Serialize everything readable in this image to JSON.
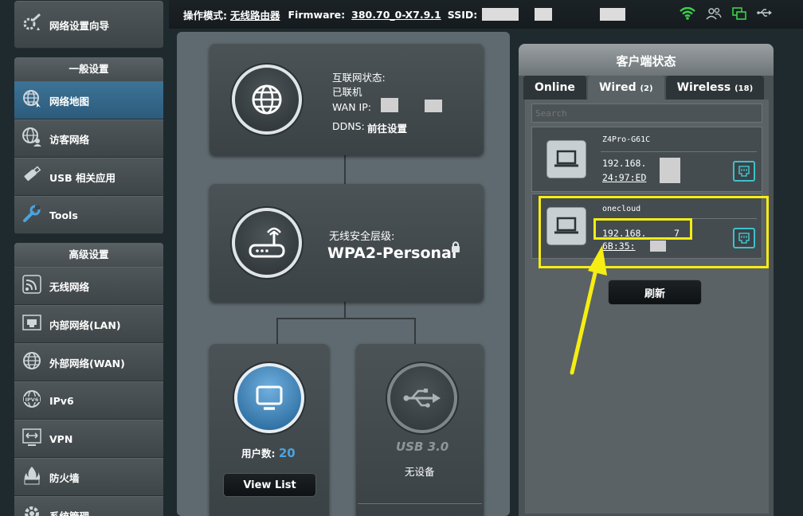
{
  "header": {
    "mode_label": "操作模式:",
    "mode_value": "无线路由器",
    "firmware_label": "Firmware:",
    "firmware_value": "380.70_0-X7.9.1",
    "ssid_label": "SSID:"
  },
  "sidebar": {
    "wizard": "网络设置向导",
    "general_title": "一般设置",
    "general_items": [
      "网络地图",
      "访客网络",
      "USB 相关应用",
      "Tools"
    ],
    "advanced_title": "高级设置",
    "advanced_items": [
      "无线网络",
      "内部网络(LAN)",
      "外部网络(WAN)",
      "IPv6",
      "VPN",
      "防火墙",
      "系统管理"
    ]
  },
  "map": {
    "internet_status_label": "互联网状态:",
    "internet_status_value": "已联机",
    "wan_ip_label": "WAN IP:",
    "ddns_label": "DDNS:",
    "ddns_value": "前往设置",
    "security_label": "无线安全层级:",
    "security_value": "WPA2-Personal",
    "clients_label": "用户数:",
    "clients_value": "20",
    "view_list": "View List",
    "usb_label": "USB 3.0",
    "usb_status": "无设备"
  },
  "clients": {
    "title": "客户端状态",
    "tabs": [
      {
        "label": "Online",
        "count": ""
      },
      {
        "label": "Wired",
        "count": "(2)"
      },
      {
        "label": "Wireless",
        "count": "(18)"
      }
    ],
    "search_placeholder": "Search",
    "devices": [
      {
        "name": "Z4Pro-G61C",
        "ip": "192.168.",
        "mac": "24:97:ED"
      },
      {
        "name": "onecloud",
        "ip": "192.168.",
        "ip_suffix": "7",
        "mac": "6B:35:"
      }
    ],
    "refresh": "刷新"
  },
  "colors": {
    "accent_blue": "#2d5b7c",
    "highlight_yellow": "#f6ed13",
    "lan_icon_cyan": "#3fc0cc"
  }
}
